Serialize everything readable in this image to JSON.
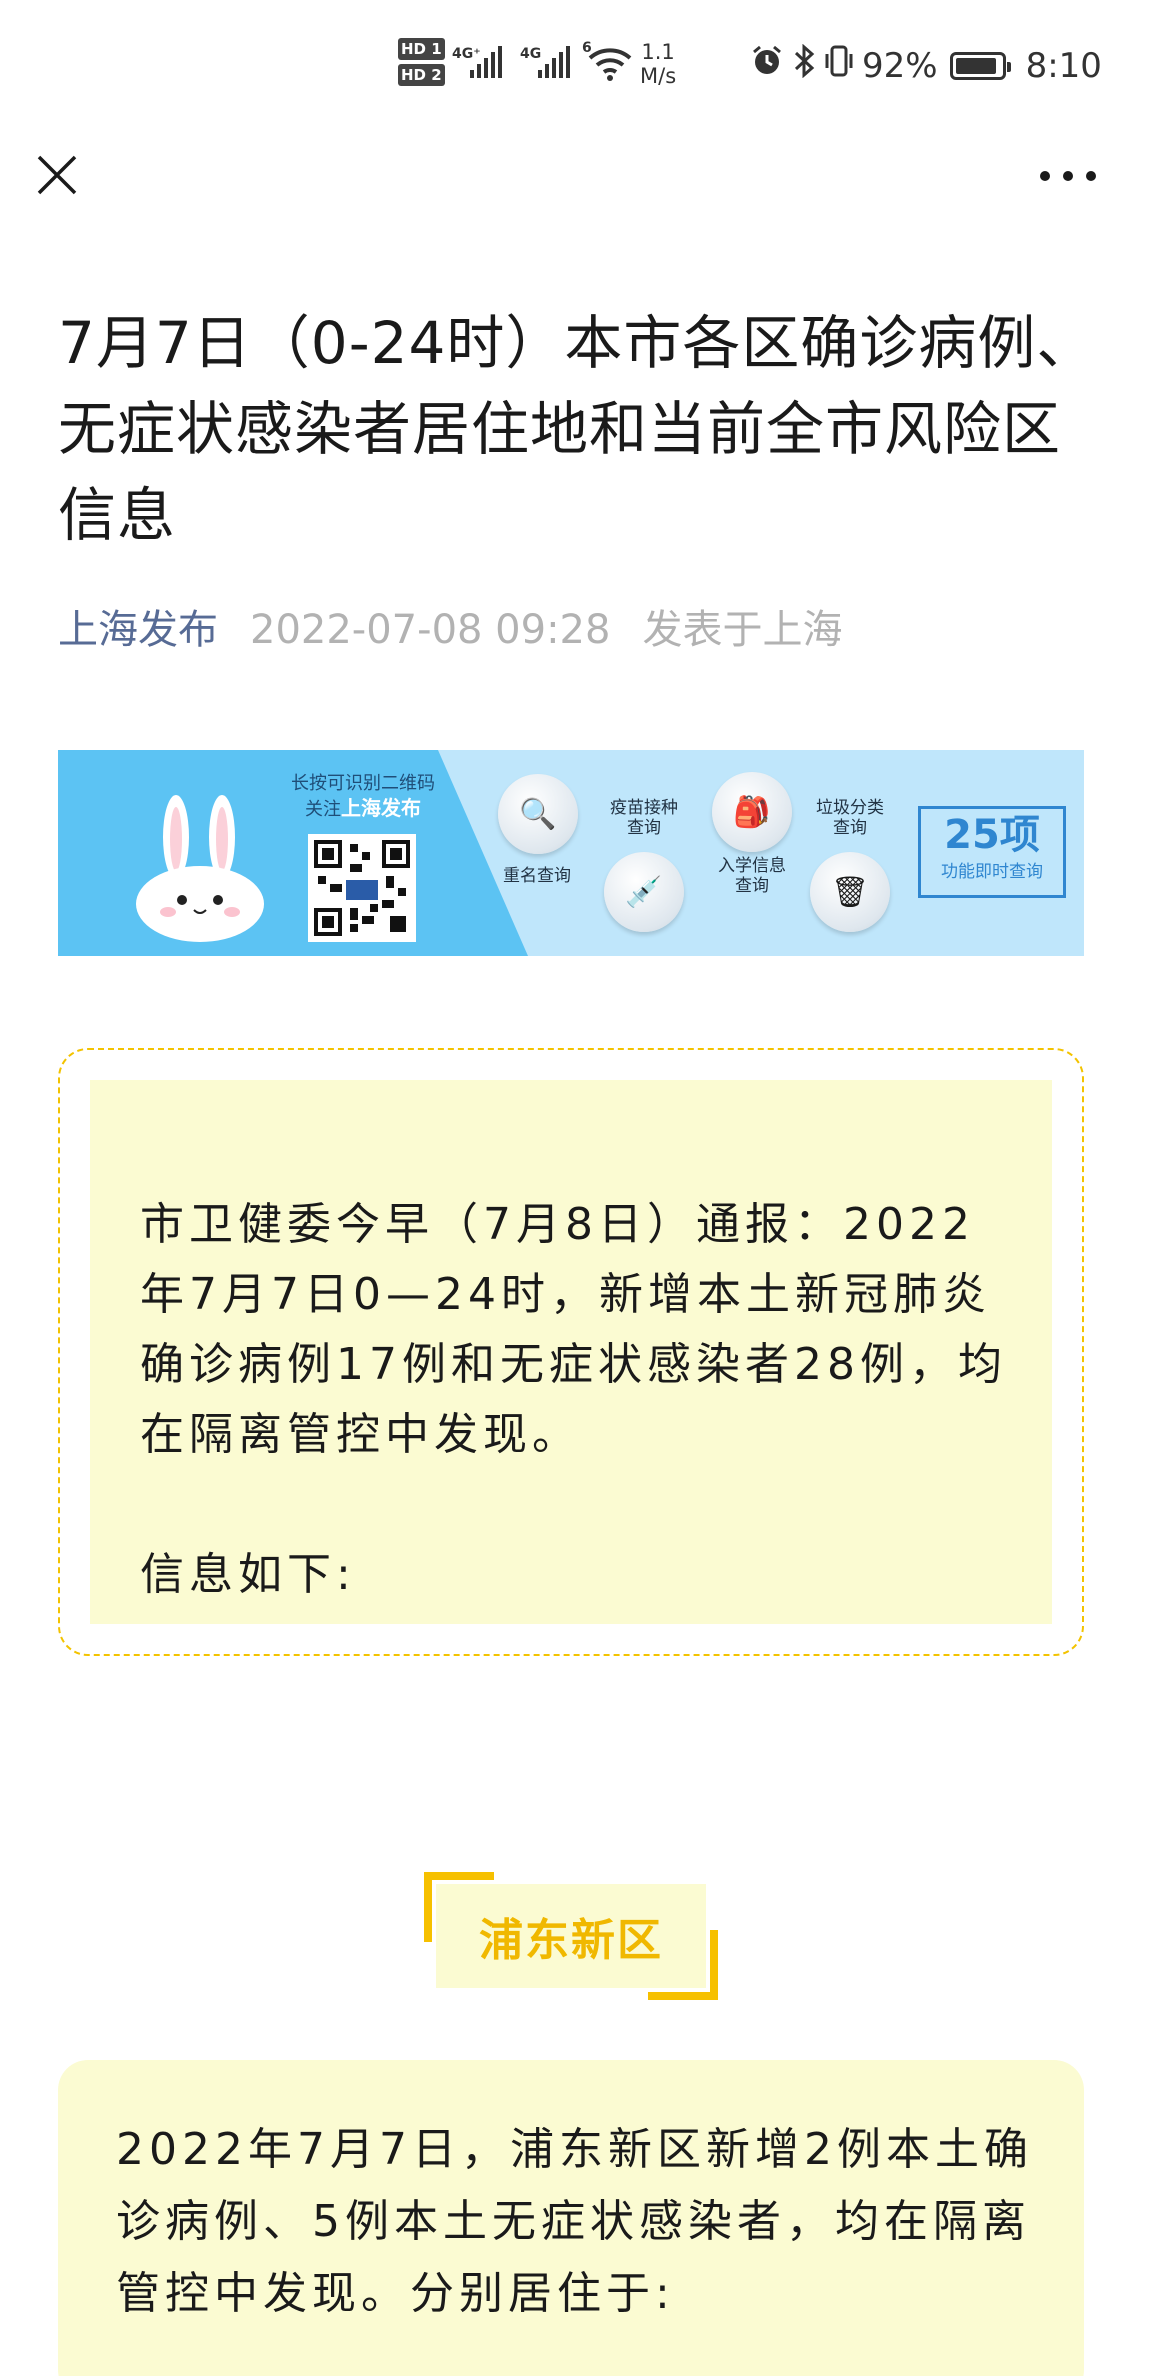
{
  "status_bar": {
    "hd1": "HD 1",
    "hd2": "HD 2",
    "sim1_tag": "4G⁺",
    "sim2_tag": "4G",
    "wifi_tag": "6",
    "speed_value": "1.1",
    "speed_unit": "M/s",
    "battery_percent": "92%",
    "battery_level": 0.92,
    "time": "8:10"
  },
  "nav": {
    "close_icon": "close-icon",
    "more_icon": "more-icon"
  },
  "article": {
    "title": "7月7日（0-24时）本市各区确诊病例、无症状感染者居住地和当前全市风险区信息",
    "author": "上海发布",
    "date": "2022-07-08 09:28",
    "location": "发表于上海"
  },
  "banner": {
    "qr_line1": "长按可识别二维码",
    "qr_line2_prefix": "关注",
    "qr_line2_brand": "上海发布",
    "item1": "重名查询",
    "item2": "疫苗接种查询",
    "item3": "入学信息查询",
    "item4": "垃圾分类查询",
    "count_big": "25项",
    "count_sub": "功能即时查询"
  },
  "notice": {
    "text": "市卫健委今早（7月8日）通报：2022年7月7日0—24时，新增本土新冠肺炎确诊病例17例和无症状感染者28例，均在隔离管控中发现。",
    "sub": "信息如下:"
  },
  "section": {
    "heading": "浦东新区",
    "body": "2022年7月7日，浦东新区新增2例本土确诊病例、5例本土无症状感染者，均在隔离管控中发现。分别居住于:"
  },
  "colors": {
    "author": "#576b95",
    "meta_gray": "#b2b2b2",
    "accent_yellow": "#f6c000",
    "panel_yellow": "#fbfbd2",
    "banner_blue": "#5cc3f3"
  }
}
